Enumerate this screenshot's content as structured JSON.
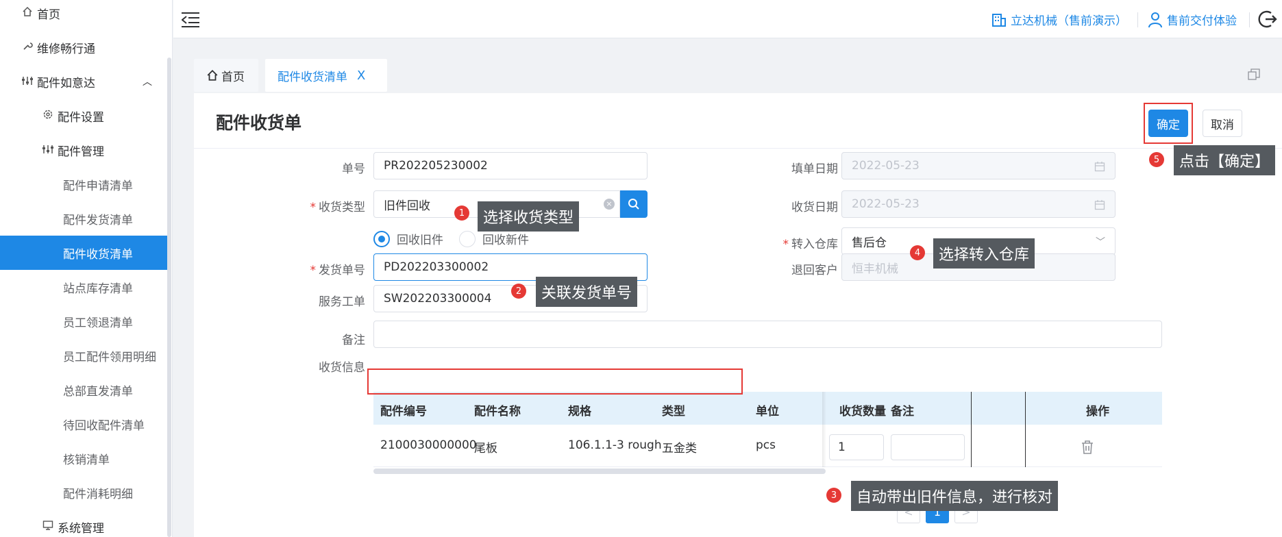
{
  "sidebar": {
    "items": [
      {
        "label": "首页",
        "icon": "home-icon"
      },
      {
        "label": "维修畅行通",
        "icon": "wrench-icon"
      },
      {
        "label": "配件如意达",
        "icon": "sliders-icon"
      },
      {
        "label": "配件设置",
        "icon": "gear-icon"
      },
      {
        "label": "配件管理",
        "icon": "sliders-icon"
      },
      {
        "label": "配件申请清单"
      },
      {
        "label": "配件发货清单"
      },
      {
        "label": "配件收货清单"
      },
      {
        "label": "站点库存清单"
      },
      {
        "label": "员工领退清单"
      },
      {
        "label": "员工配件领用明细"
      },
      {
        "label": "总部直发清单"
      },
      {
        "label": "待回收配件清单"
      },
      {
        "label": "核销清单"
      },
      {
        "label": "配件消耗明细"
      },
      {
        "label": "系统管理",
        "icon": "monitor-icon"
      }
    ]
  },
  "header": {
    "company": "立达机械（售前演示）",
    "user": "售前交付体验"
  },
  "tabs": [
    {
      "label": "首页"
    },
    {
      "label": "配件收货清单",
      "close": "X"
    }
  ],
  "form": {
    "title": "配件收货单",
    "ok_label": "确定",
    "cancel_label": "取消",
    "order_no": {
      "label": "单号",
      "value": "PR202205230002"
    },
    "fill_date": {
      "label": "填单日期",
      "value": "2022-05-23"
    },
    "receive_type": {
      "label": "收货类型",
      "value": "旧件回收"
    },
    "receive_date": {
      "label": "收货日期",
      "value": "2022-05-23"
    },
    "radio_old": "回收旧件",
    "radio_new": "回收新件",
    "warehouse": {
      "label": "转入仓库",
      "value": "售后仓"
    },
    "ship_no": {
      "label": "发货单号",
      "value": "PD202203300002"
    },
    "return_customer": {
      "label": "退回客户",
      "value": "恒丰机械"
    },
    "service_order": {
      "label": "服务工单",
      "value": "SW202203300004"
    },
    "remark": {
      "label": "备注",
      "value": ""
    },
    "receive_info_label": "收货信息"
  },
  "table": {
    "headers": [
      "配件编号",
      "配件名称",
      "规格",
      "类型",
      "单位",
      "收货数量",
      "备注",
      "操作"
    ],
    "rows": [
      {
        "code": "2100030000000",
        "name": "尾板",
        "spec": "106.1.1-3 rough",
        "type": "五金类",
        "unit": "pcs",
        "qty": "1",
        "remark": ""
      }
    ]
  },
  "pager": {
    "prev": "<",
    "current": "1",
    "next": ">"
  },
  "callouts": [
    {
      "num": "1",
      "text": "选择收货类型"
    },
    {
      "num": "2",
      "text": "关联发货单号"
    },
    {
      "num": "3",
      "text": "自动带出旧件信息，进行核对"
    },
    {
      "num": "4",
      "text": "选择转入仓库"
    },
    {
      "num": "5",
      "text": "点击【确定】"
    }
  ],
  "colors": {
    "accent": "#1e88e5",
    "annotation": "#e53935",
    "callout_bg": "#555a5f"
  }
}
